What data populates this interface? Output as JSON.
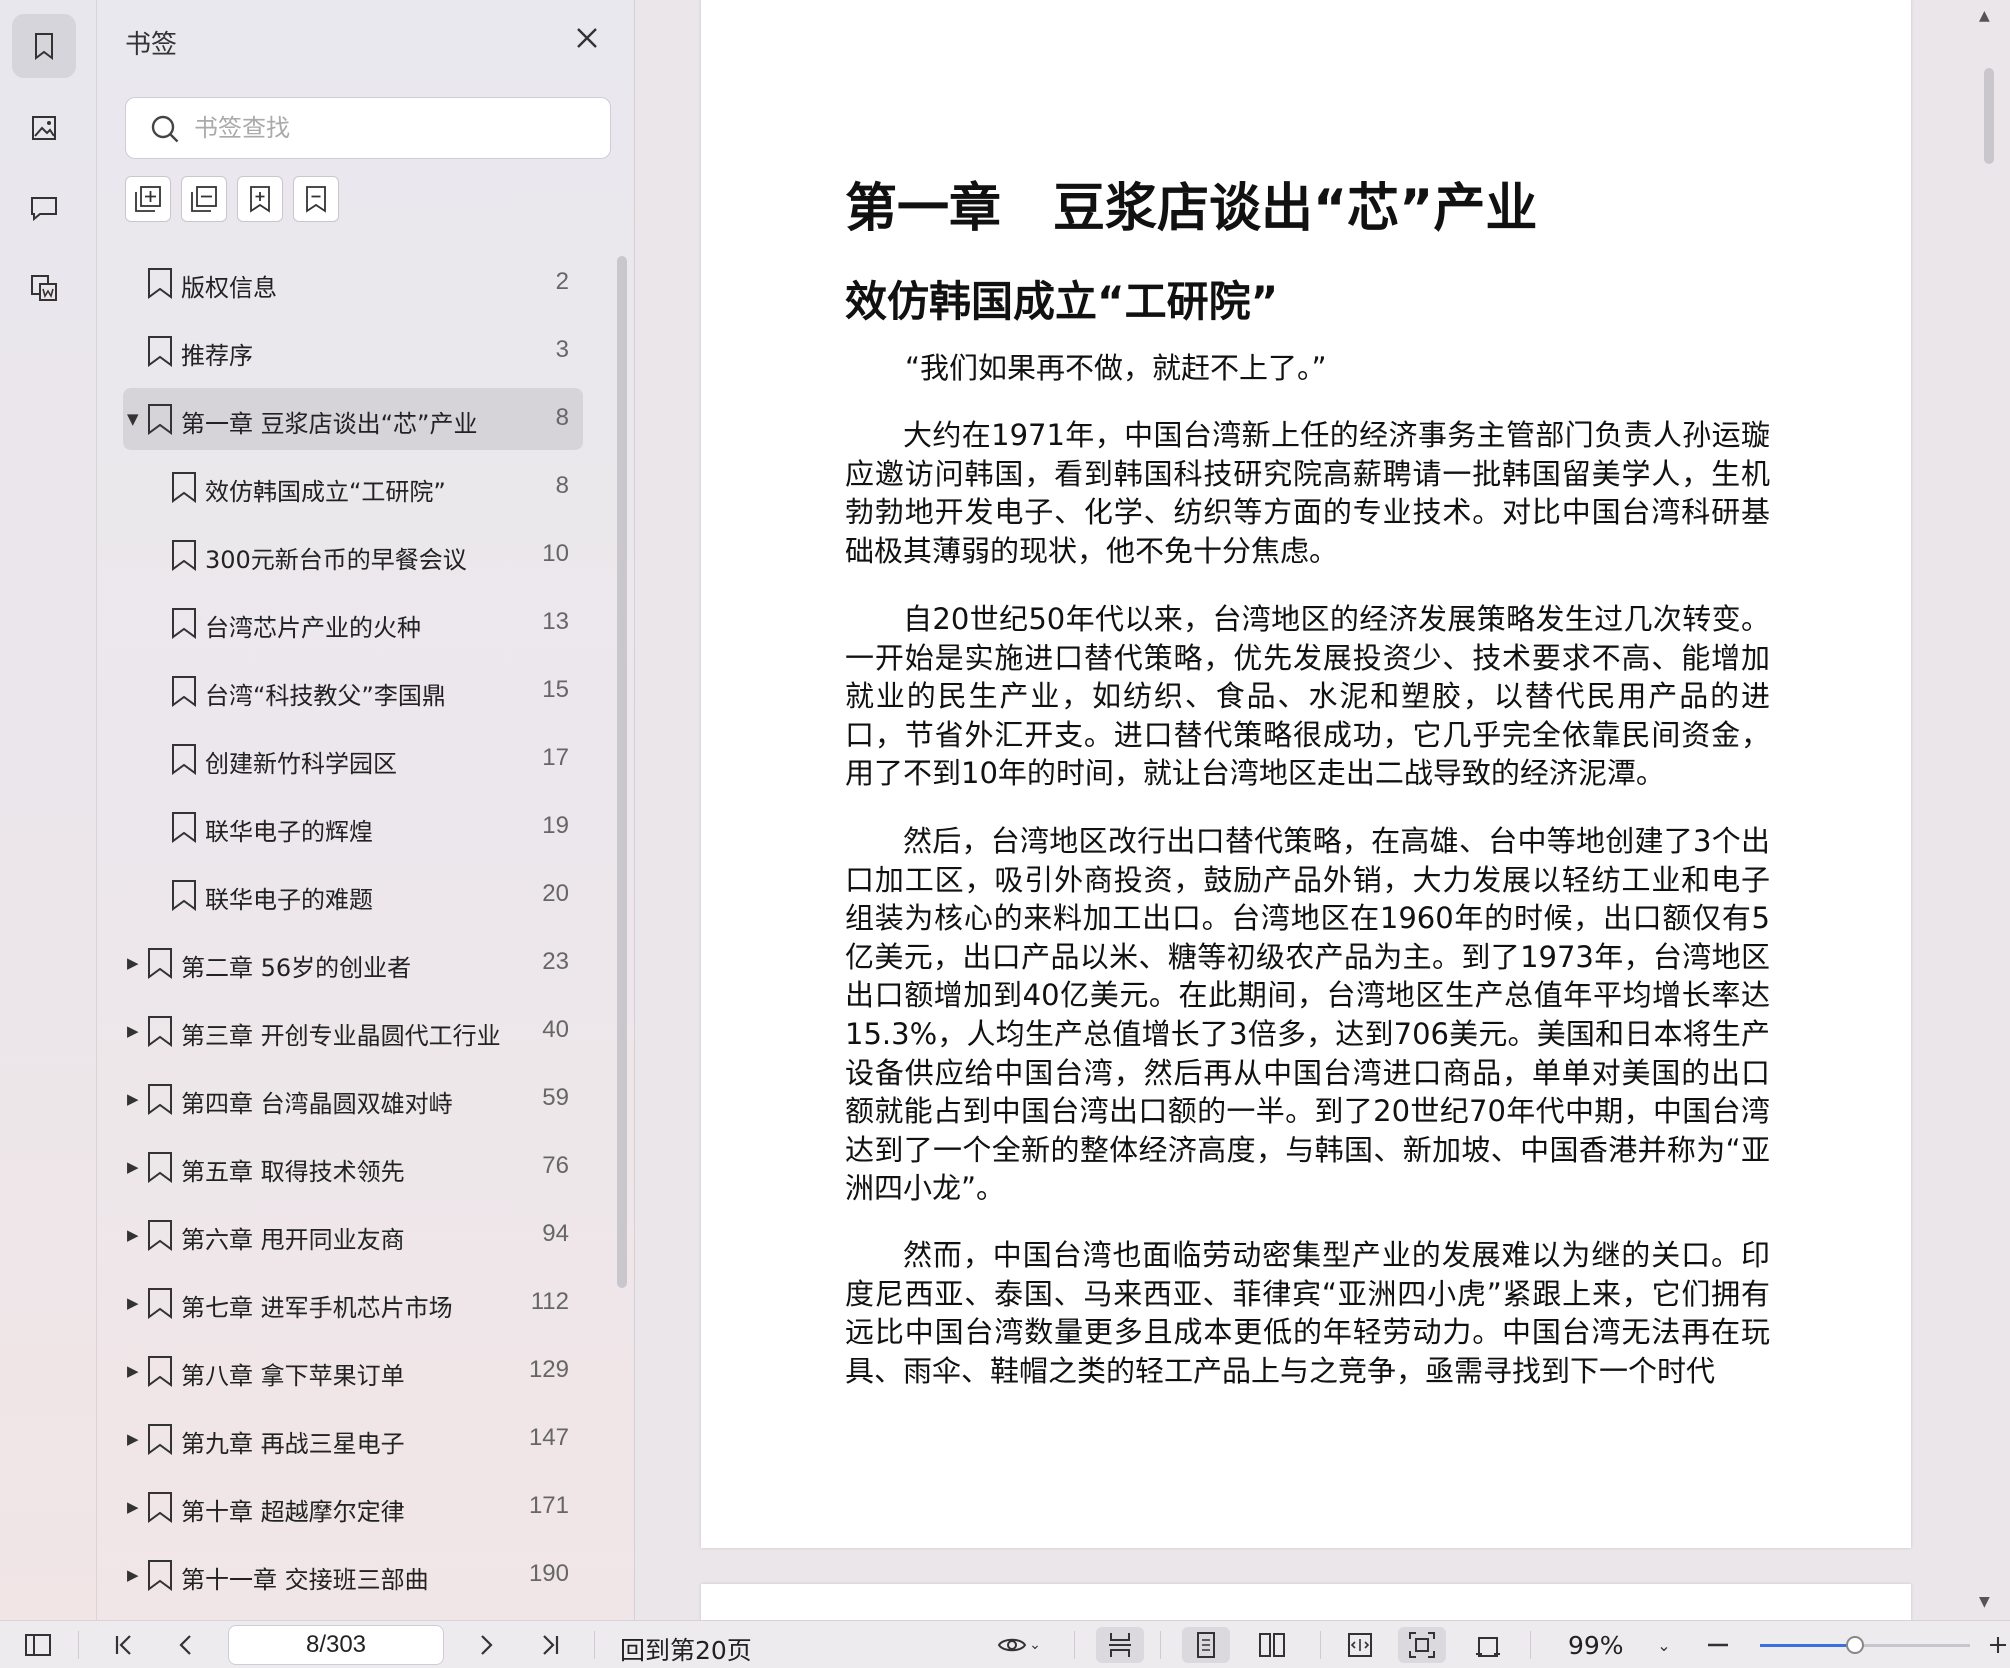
{
  "rail": {
    "items": [
      {
        "name": "bookmark"
      },
      {
        "name": "thumbnail"
      },
      {
        "name": "comment"
      },
      {
        "name": "attachment"
      }
    ]
  },
  "bookmarks_panel": {
    "title": "书签",
    "search_placeholder": "书签查找",
    "items": [
      {
        "label": "版权信息",
        "page": "2",
        "level": 0,
        "caret": ""
      },
      {
        "label": "推荐序",
        "page": "3",
        "level": 0,
        "caret": ""
      },
      {
        "label": "第一章 豆浆店谈出“芯”产业",
        "page": "8",
        "level": 0,
        "caret": "▼",
        "selected": true
      },
      {
        "label": "效仿韩国成立“工研院”",
        "page": "8",
        "level": 1,
        "caret": ""
      },
      {
        "label": "300元新台币的早餐会议",
        "page": "10",
        "level": 1,
        "caret": ""
      },
      {
        "label": "台湾芯片产业的火种",
        "page": "13",
        "level": 1,
        "caret": ""
      },
      {
        "label": "台湾“科技教父”李国鼎",
        "page": "15",
        "level": 1,
        "caret": ""
      },
      {
        "label": "创建新竹科学园区",
        "page": "17",
        "level": 1,
        "caret": ""
      },
      {
        "label": "联华电子的辉煌",
        "page": "19",
        "level": 1,
        "caret": ""
      },
      {
        "label": "联华电子的难题",
        "page": "20",
        "level": 1,
        "caret": ""
      },
      {
        "label": "第二章 56岁的创业者",
        "page": "23",
        "level": 0,
        "caret": "▶"
      },
      {
        "label": "第三章 开创专业晶圆代工行业",
        "page": "40",
        "level": 0,
        "caret": "▶"
      },
      {
        "label": "第四章 台湾晶圆双雄对峙",
        "page": "59",
        "level": 0,
        "caret": "▶"
      },
      {
        "label": "第五章 取得技术领先",
        "page": "76",
        "level": 0,
        "caret": "▶"
      },
      {
        "label": "第六章 甩开同业友商",
        "page": "94",
        "level": 0,
        "caret": "▶"
      },
      {
        "label": "第七章 进军手机芯片市场",
        "page": "112",
        "level": 0,
        "caret": "▶"
      },
      {
        "label": "第八章 拿下苹果订单",
        "page": "129",
        "level": 0,
        "caret": "▶"
      },
      {
        "label": "第九章 再战三星电子",
        "page": "147",
        "level": 0,
        "caret": "▶"
      },
      {
        "label": "第十章 超越摩尔定律",
        "page": "171",
        "level": 0,
        "caret": "▶"
      },
      {
        "label": "第十一章 交接班三部曲",
        "page": "190",
        "level": 0,
        "caret": "▶"
      }
    ]
  },
  "document": {
    "chapter_title": "第一章　豆浆店谈出“芯”产业",
    "section_title": "效仿韩国成立“工研院”",
    "quote": "“我们如果再不做，就赶不上了。”",
    "paragraphs": [
      "大约在1971年，中国台湾新上任的经济事务主管部门负责人孙运璇应邀访问韩国，看到韩国科技研究院高薪聘请一批韩国留美学人，生机勃勃地开发电子、化学、纺织等方面的专业技术。对比中国台湾科研基础极其薄弱的现状，他不免十分焦虑。",
      "自20世纪50年代以来，台湾地区的经济发展策略发生过几次转变。一开始是实施进口替代策略，优先发展投资少、技术要求不高、能增加就业的民生产业，如纺织、食品、水泥和塑胶，以替代民用产品的进口，节省外汇开支。进口替代策略很成功，它几乎完全依靠民间资金，用了不到10年的时间，就让台湾地区走出二战导致的经济泥潭。",
      "然后，台湾地区改行出口替代策略，在高雄、台中等地创建了3个出口加工区，吸引外商投资，鼓励产品外销，大力发展以轻纺工业和电子组装为核心的来料加工出口。台湾地区在1960年的时候，出口额仅有5亿美元，出口产品以米、糖等初级农产品为主。到了1973年，台湾地区出口额增加到40亿美元。在此期间，台湾地区生产总值年平均增长率达15.3%，人均生产总值增长了3倍多，达到706美元。美国和日本将生产设备供应给中国台湾，然后再从中国台湾进口商品，单单对美国的出口额就能占到中国台湾出口额的一半。到了20世纪70年代中期，中国台湾达到了一个全新的整体经济高度，与韩国、新加坡、中国香港并称为“亚洲四小龙”。",
      "然而，中国台湾也面临劳动密集型产业的发展难以为继的关口。印度尼西亚、泰国、马来西亚、菲律宾“亚洲四小虎”紧跟上来，它们拥有远比中国台湾数量更多且成本更低的年轻劳动力。中国台湾无法再在玩具、雨伞、鞋帽之类的轻工产品上与之竞争，亟需寻找到下一个时代"
    ]
  },
  "statusbar": {
    "page_value": "8/303",
    "back_to_label": "回到第20页",
    "zoom_label": "99%",
    "zoom_fraction": 0.45
  },
  "colors": {
    "accent": "#3b6fe0",
    "panel_bg": "#e9e8ee",
    "selected_bg": "#d6d3d9"
  }
}
